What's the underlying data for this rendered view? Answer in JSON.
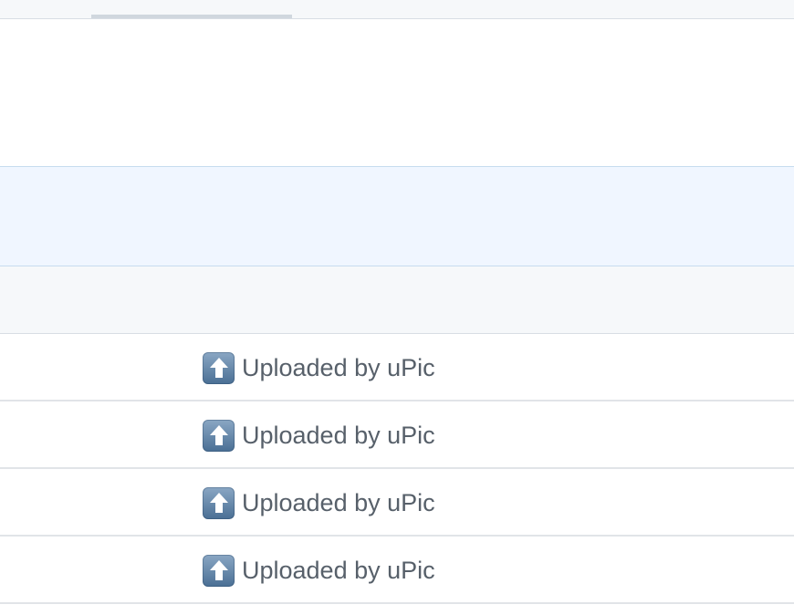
{
  "repository": {
    "files": [
      {
        "icon": "up-arrow-icon",
        "commit_message": "Uploaded by uPic"
      },
      {
        "icon": "up-arrow-icon",
        "commit_message": "Uploaded by uPic"
      },
      {
        "icon": "up-arrow-icon",
        "commit_message": "Uploaded by uPic"
      },
      {
        "icon": "up-arrow-icon",
        "commit_message": "Uploaded by uPic"
      }
    ]
  },
  "colors": {
    "header_bg": "#f6f8fa",
    "flash_bg": "#f0f6ff",
    "text_muted": "#57606a",
    "icon_blue": "#5b7fa6"
  }
}
